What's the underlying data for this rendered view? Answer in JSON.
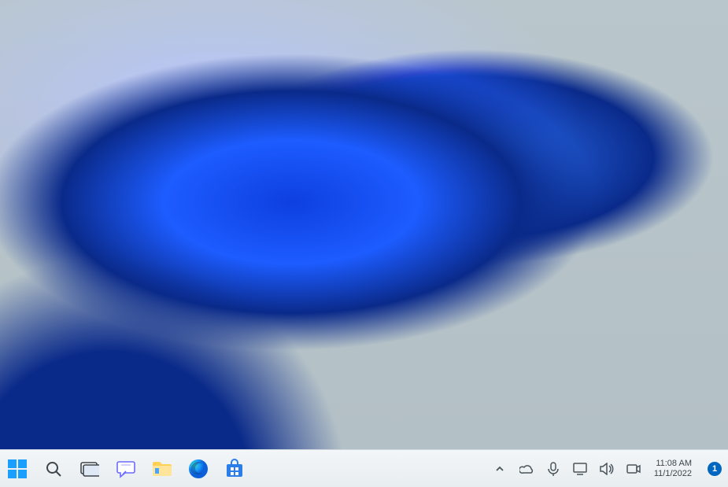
{
  "taskbar": {
    "pinned": [
      {
        "name": "start-button",
        "icon": "windows-logo"
      },
      {
        "name": "search-button",
        "icon": "search-icon"
      },
      {
        "name": "task-view-button",
        "icon": "task-view-icon"
      },
      {
        "name": "chat-button",
        "icon": "chat-icon"
      },
      {
        "name": "file-explorer-button",
        "icon": "folder-icon"
      },
      {
        "name": "edge-button",
        "icon": "edge-icon"
      },
      {
        "name": "microsoft-store-button",
        "icon": "store-icon"
      }
    ]
  },
  "systray": {
    "items": [
      {
        "name": "show-hidden-icons-button",
        "icon": "chevron-up-icon"
      },
      {
        "name": "onedrive-tray",
        "icon": "cloud-icon"
      },
      {
        "name": "microphone-tray",
        "icon": "microphone-icon"
      },
      {
        "name": "network-tray",
        "icon": "display-icon"
      },
      {
        "name": "volume-tray",
        "icon": "speaker-icon"
      },
      {
        "name": "camera-tray",
        "icon": "camera-icon"
      }
    ],
    "clock": {
      "time": "11:08 AM",
      "date": "11/1/2022"
    },
    "notifications": {
      "count": "1"
    }
  },
  "colors": {
    "accent": "#0067c0",
    "taskbar_bg": "#eef2f4"
  }
}
